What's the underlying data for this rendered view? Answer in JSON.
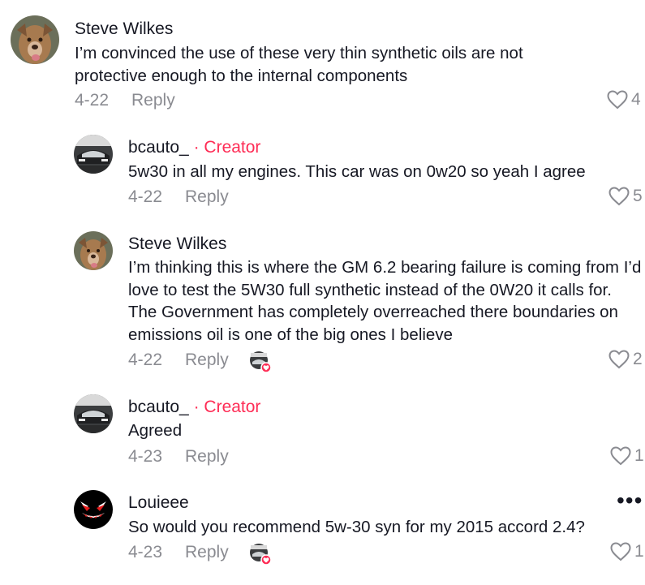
{
  "comments": [
    {
      "author": "Steve Wilkes",
      "text": "I’m convinced the use of these very thin synthetic oils are not protective enough to the internal components",
      "date": "4-22",
      "reply_label": "Reply",
      "likes": "4",
      "avatar_icon": "dog-avatar"
    },
    {
      "author": "bcauto_",
      "creator_tag": "· Creator",
      "text": "5w30 in all my engines. This car was on 0w20 so yeah I agree",
      "date": "4-22",
      "reply_label": "Reply",
      "likes": "5",
      "avatar_icon": "car-avatar"
    },
    {
      "author": "Steve Wilkes",
      "text": "I’m thinking this is where the GM 6.2 bearing failure is coming from I’d love to test the 5W30 full synthetic instead of the 0W20 it calls for. The Government has completely overreached there boundaries on emissions oil is one of the big ones I believe",
      "date": "4-22",
      "reply_label": "Reply",
      "likes": "2",
      "creator_liked": true,
      "avatar_icon": "dog-avatar"
    },
    {
      "author": "bcauto_",
      "creator_tag": "· Creator",
      "text": "Agreed",
      "date": "4-23",
      "reply_label": "Reply",
      "likes": "1",
      "avatar_icon": "car-avatar"
    },
    {
      "author": "Louieee",
      "text": "So would you recommend 5w-30 syn for my 2015 accord 2.4?",
      "date": "4-23",
      "reply_label": "Reply",
      "likes": "1",
      "creator_liked": true,
      "more_icon": "more-options-icon",
      "avatar_icon": "devil-face-avatar"
    }
  ],
  "colors": {
    "creator": "#fe2c55",
    "meta": "#8a8b91",
    "text": "#161823"
  }
}
